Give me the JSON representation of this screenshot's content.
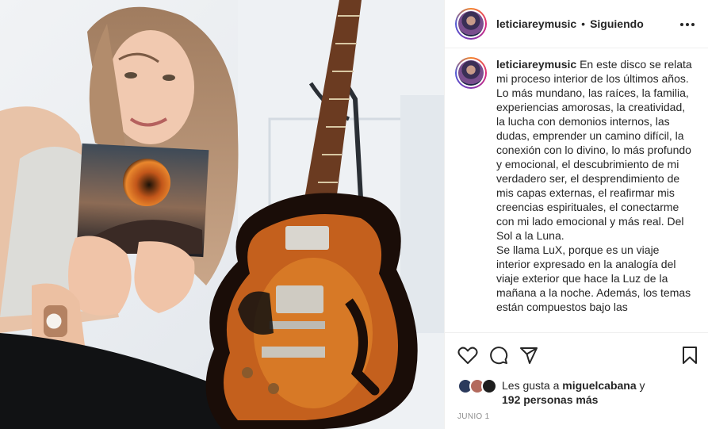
{
  "post": {
    "username": "leticiareymusic",
    "separator": "•",
    "follow_status": "Siguiendo"
  },
  "caption": {
    "username": "leticiareymusic",
    "text": "En este disco se relata mi proceso interior de los últimos años. Lo más mundano, las raíces, la familia, experiencias amorosas, la creatividad, la lucha con demonios internos, las dudas, emprender un camino difícil, la conexión con lo divino, lo más profundo y emocional, el descubrimiento de mi verdadero ser, el desprendimiento de mis capas externas, el reafirmar mis creencias espirituales, el conectarme con mi lado emocional y más real. Del Sol a la Luna.\nSe llama LuX, porque es un viaje interior expresado en la analogía del viaje exterior que hace la Luz de la mañana a la noche. Además, los temas están compuestos bajo las"
  },
  "actions": {
    "like_icon": "heart-icon",
    "comment_icon": "comment-icon",
    "share_icon": "paper-plane-icon",
    "save_icon": "bookmark-icon"
  },
  "likes": {
    "prefix": "Les gusta a",
    "user": "miguelcabana",
    "connector": "y",
    "others": "192 personas más"
  },
  "date": "JUNIO 1",
  "colors": {
    "text": "#262626",
    "secondary": "#8e8e8e",
    "divider": "#efefef"
  }
}
